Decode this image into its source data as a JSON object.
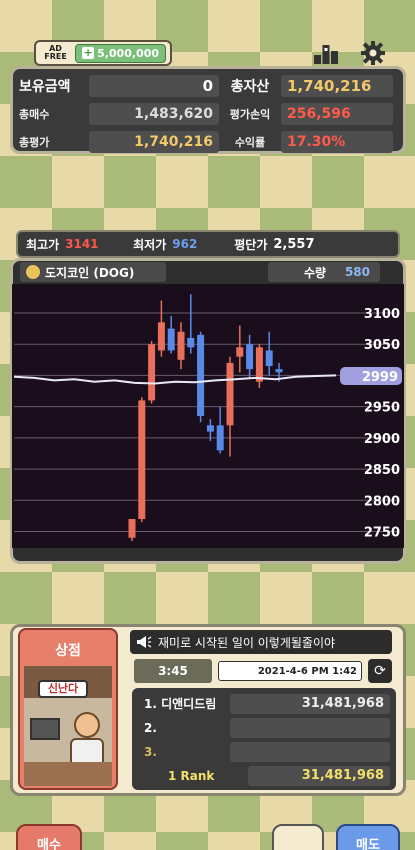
{
  "topbar": {
    "adfree_line1": "AD",
    "adfree_line2": "FREE",
    "adfree_price": "5,000,000"
  },
  "assets": {
    "holding_label": "보유금액",
    "holding_value": "0",
    "total_label": "총자산",
    "total_value": "1,740,216",
    "buy_label": "총매수",
    "buy_value": "1,483,620",
    "pnl_label": "평가손익",
    "pnl_value": "256,596",
    "eval_label": "총평가",
    "eval_value": "1,740,216",
    "rate_label": "수익률",
    "rate_value": "17.30%"
  },
  "stats": {
    "high_label": "최고가",
    "high_value": "3141",
    "low_label": "최저가",
    "low_value": "962",
    "avg_label": "평단가",
    "avg_value": "2,557"
  },
  "coin": {
    "name": "도지코인 (DOG)",
    "qty_label": "수량",
    "qty_value": "580",
    "current_price": "2999"
  },
  "chart_data": {
    "type": "candlestick",
    "y_ticks": [
      "3100",
      "3050",
      "3000",
      "2950",
      "2900",
      "2850",
      "2800",
      "2750"
    ],
    "ylim": [
      2730,
      3140
    ],
    "up_color": "#e8705a",
    "down_color": "#5a8ae8",
    "candles": [
      {
        "o": 2740,
        "c": 2770,
        "h": 2770,
        "l": 2735
      },
      {
        "o": 2770,
        "c": 2960,
        "h": 2965,
        "l": 2765
      },
      {
        "o": 2960,
        "c": 3050,
        "h": 3055,
        "l": 2955
      },
      {
        "o": 3040,
        "c": 3085,
        "h": 3120,
        "l": 3030
      },
      {
        "o": 3075,
        "c": 3040,
        "h": 3095,
        "l": 3035
      },
      {
        "o": 3025,
        "c": 3070,
        "h": 3085,
        "l": 3010
      },
      {
        "o": 3060,
        "c": 3045,
        "h": 3130,
        "l": 3035
      },
      {
        "o": 3065,
        "c": 2935,
        "h": 3070,
        "l": 2925
      },
      {
        "o": 2920,
        "c": 2910,
        "h": 2930,
        "l": 2895
      },
      {
        "o": 2920,
        "c": 2880,
        "h": 2950,
        "l": 2875
      },
      {
        "o": 2920,
        "c": 3020,
        "h": 3030,
        "l": 2870
      },
      {
        "o": 3030,
        "c": 3045,
        "h": 3080,
        "l": 3005
      },
      {
        "o": 3050,
        "c": 3010,
        "h": 3065,
        "l": 2995
      },
      {
        "o": 2990,
        "c": 3045,
        "h": 3050,
        "l": 2980
      },
      {
        "o": 3040,
        "c": 3015,
        "h": 3070,
        "l": 3000
      },
      {
        "o": 3010,
        "c": 3005,
        "h": 3020,
        "l": 2990
      }
    ],
    "avg_line": [
      2998,
      2996,
      2992,
      2994,
      2990,
      2992,
      2988,
      2987,
      2990,
      2989,
      2992,
      2994,
      2996,
      2994,
      2998,
      2999,
      3000
    ]
  },
  "shop": {
    "title": "상점",
    "sign": "신난다"
  },
  "news": {
    "text": "재미로 시작된 일이 이렇게될줄이야"
  },
  "clock": {
    "time": "3:45",
    "date": "2021-4-6 PM 1:42"
  },
  "ranking": {
    "rows": [
      {
        "name": "1. 디앤디드림",
        "value": "31,481,968"
      },
      {
        "name": "2.",
        "value": ""
      },
      {
        "name": "3.",
        "value": ""
      }
    ],
    "my_rank_label": "1 Rank",
    "my_rank_value": "31,481,968"
  },
  "buttons": {
    "buy": "매수",
    "sell": "매도"
  }
}
